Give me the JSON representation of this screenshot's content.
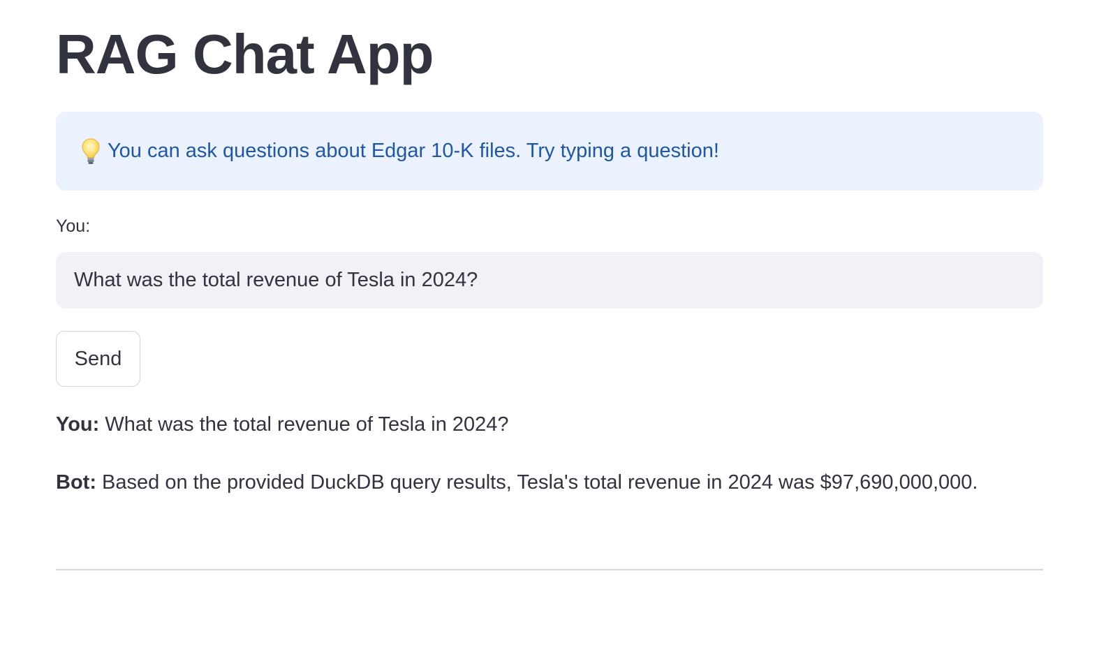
{
  "app": {
    "title": "RAG Chat App"
  },
  "info": {
    "icon": "lightbulb-icon",
    "text": "You can ask questions about Edgar 10-K files. Try typing a question!",
    "background_color": "#ebf2fd",
    "text_color": "#1f57a1"
  },
  "input": {
    "label": "You:",
    "value": "What was the total revenue of Tesla in 2024?"
  },
  "send_button": {
    "label": "Send"
  },
  "messages": [
    {
      "speaker": "You:",
      "text": " What was the total revenue of Tesla in 2024?"
    },
    {
      "speaker": "Bot:",
      "text": " Based on the provided DuckDB query results, Tesla's total revenue in 2024 was $97,690,000,000."
    }
  ]
}
